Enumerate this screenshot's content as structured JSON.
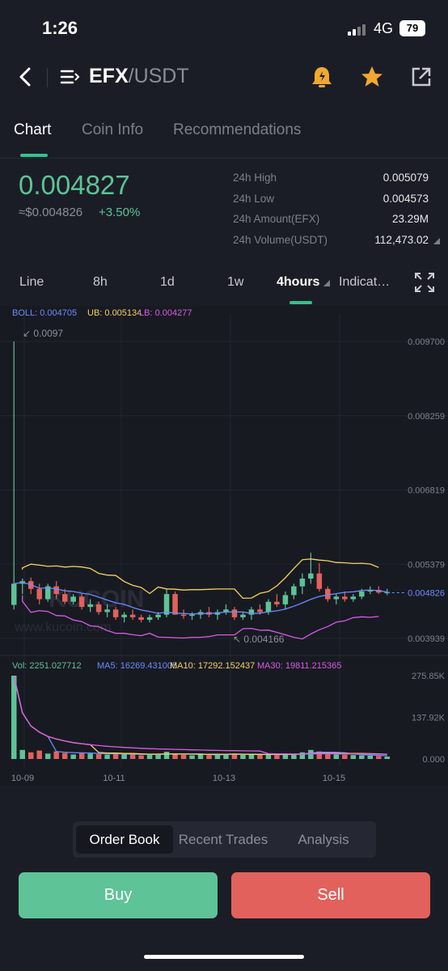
{
  "status": {
    "time": "1:26",
    "network": "4G",
    "battery": "79"
  },
  "nav": {
    "base": "EFX",
    "quote": "/USDT"
  },
  "tabs": [
    {
      "label": "Chart"
    },
    {
      "label": "Coin Info"
    },
    {
      "label": "Recommendations"
    }
  ],
  "ticker": {
    "price": "0.004827",
    "fiat": "≈$0.004826",
    "change": "+3.50%",
    "stats": [
      {
        "label": "24h High",
        "value": "0.005079"
      },
      {
        "label": "24h Low",
        "value": "0.004573"
      },
      {
        "label": "24h Amount(EFX)",
        "value": "23.29M"
      },
      {
        "label": "24h Volume(USDT)",
        "value": "112,473.02"
      }
    ]
  },
  "intervals": [
    {
      "label": "Line"
    },
    {
      "label": "8h"
    },
    {
      "label": "1d"
    },
    {
      "label": "1w"
    },
    {
      "label": "4hours"
    },
    {
      "label": "Indicat…"
    }
  ],
  "chart_data": {
    "type": "candlestick",
    "indicators": {
      "boll": "BOLL: 0.004705",
      "ub": "UB: 0.005134",
      "lb": "LB: 0.004277",
      "vol": "Vol: 2251.027712",
      "ma5": "MA5: 16269.431005",
      "ma10": "MA10: 17292.152437",
      "ma30": "MA30: 19811.215365"
    },
    "price_ticks": [
      "0.009700",
      "0.008259",
      "0.006819",
      "0.005379",
      "0.003939"
    ],
    "ylim": [
      0.003939,
      0.0097
    ],
    "volume_ticks": [
      "275.85K",
      "137.92K",
      "0.000"
    ],
    "x_ticks": [
      "10-09",
      "10-11",
      "10-13",
      "10-15"
    ],
    "last_price_label": "0.004826",
    "last_price": 0.004826,
    "max_label": "0.0097",
    "min_label": "0.004166",
    "watermark": "KUCOIN",
    "watermark_url": "www.kucoin.com",
    "colors": {
      "up": "#5ec396",
      "down": "#e2615c",
      "boll": "#6c8cff",
      "ub": "#f4d35e",
      "lb": "#d65ce6",
      "ma30": "#d65ce6"
    },
    "candles": [
      [
        0.00459,
        0.0097,
        0.0045,
        0.005
      ],
      [
        0.005,
        0.0051,
        0.0048,
        0.00505
      ],
      [
        0.00505,
        0.00512,
        0.0048,
        0.0049
      ],
      [
        0.0049,
        0.005,
        0.0046,
        0.0047
      ],
      [
        0.0047,
        0.005,
        0.00465,
        0.00495
      ],
      [
        0.00495,
        0.00505,
        0.0047,
        0.0048
      ],
      [
        0.0048,
        0.0049,
        0.0046,
        0.00465
      ],
      [
        0.00465,
        0.0048,
        0.0046,
        0.00475
      ],
      [
        0.00475,
        0.0048,
        0.0045,
        0.00455
      ],
      [
        0.00455,
        0.0047,
        0.00445,
        0.0046
      ],
      [
        0.0046,
        0.00465,
        0.0044,
        0.00445
      ],
      [
        0.00445,
        0.0046,
        0.00435,
        0.0045
      ],
      [
        0.0045,
        0.00455,
        0.0043,
        0.00435
      ],
      [
        0.00435,
        0.00445,
        0.00425,
        0.0044
      ],
      [
        0.0044,
        0.0045,
        0.0043,
        0.00435
      ],
      [
        0.00435,
        0.0044,
        0.00425,
        0.0043
      ],
      [
        0.0043,
        0.0044,
        0.00425,
        0.00435
      ],
      [
        0.00435,
        0.00445,
        0.0043,
        0.0044
      ],
      [
        0.0044,
        0.0049,
        0.00435,
        0.0048
      ],
      [
        0.0048,
        0.00485,
        0.0044,
        0.0044
      ],
      [
        0.0044,
        0.0045,
        0.00432,
        0.00438
      ],
      [
        0.00438,
        0.00445,
        0.0043,
        0.0044
      ],
      [
        0.0044,
        0.0045,
        0.00432,
        0.00445
      ],
      [
        0.00445,
        0.00455,
        0.00435,
        0.0044
      ],
      [
        0.0044,
        0.0045,
        0.0043,
        0.00445
      ],
      [
        0.00445,
        0.0046,
        0.0044,
        0.0045
      ],
      [
        0.0045,
        0.00455,
        0.0043,
        0.00435
      ],
      [
        0.00435,
        0.00445,
        0.0043,
        0.0044
      ],
      [
        0.0044,
        0.00455,
        0.0043,
        0.0045
      ],
      [
        0.0045,
        0.0046,
        0.0044,
        0.00445
      ],
      [
        0.00445,
        0.0047,
        0.0044,
        0.00465
      ],
      [
        0.00465,
        0.0048,
        0.00455,
        0.0046
      ],
      [
        0.0046,
        0.00485,
        0.0045,
        0.00478
      ],
      [
        0.00478,
        0.005,
        0.0047,
        0.00495
      ],
      [
        0.00495,
        0.0052,
        0.0048,
        0.0051
      ],
      [
        0.0051,
        0.0056,
        0.005,
        0.0052
      ],
      [
        0.0052,
        0.0054,
        0.00485,
        0.0049
      ],
      [
        0.0049,
        0.00495,
        0.00465,
        0.0047
      ],
      [
        0.0047,
        0.0048,
        0.0046,
        0.00475
      ],
      [
        0.00475,
        0.00485,
        0.00465,
        0.0047
      ],
      [
        0.0047,
        0.0048,
        0.00465,
        0.00475
      ],
      [
        0.00475,
        0.0049,
        0.0047,
        0.00485
      ],
      [
        0.00485,
        0.00495,
        0.0048,
        0.00488
      ],
      [
        0.00488,
        0.00495,
        0.0048,
        0.00483
      ],
      [
        0.00483,
        0.0049,
        0.00478,
        0.00484
      ]
    ],
    "volumes": [
      275850,
      30000,
      22000,
      28000,
      18000,
      25000,
      20000,
      15000,
      22000,
      18000,
      16000,
      14000,
      19000,
      15000,
      17000,
      12000,
      14000,
      16000,
      24000,
      18000,
      14000,
      12000,
      16000,
      13000,
      15000,
      17000,
      18000,
      14000,
      16000,
      15000,
      14000,
      13000,
      16000,
      18000,
      22000,
      30000,
      25000,
      18000,
      15000,
      14000,
      13000,
      12000,
      11000,
      10000,
      8000
    ]
  },
  "segments": [
    {
      "label": "Order Book"
    },
    {
      "label": "Recent Trades"
    },
    {
      "label": "Analysis"
    }
  ],
  "actions": {
    "buy": "Buy",
    "sell": "Sell"
  }
}
